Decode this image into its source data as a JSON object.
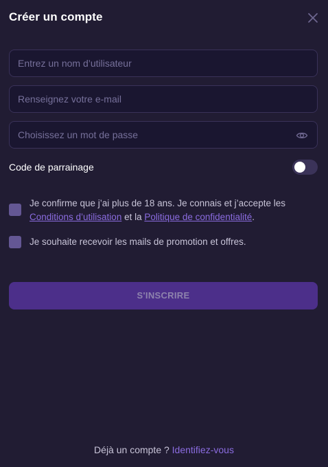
{
  "header": {
    "title": "Créer un compte"
  },
  "form": {
    "username_placeholder": "Entrez un nom d’utilisateur",
    "email_placeholder": "Renseignez votre e-mail",
    "password_placeholder": "Choisissez un mot de passe",
    "referral_label": "Code de parrainage",
    "referral_toggle_on": false,
    "terms_text_1": "Je confirme que j’ai plus de 18 ans. Je connais et j’accepte les ",
    "terms_link": "Conditions d’utilisation",
    "terms_text_2": " et la ",
    "privacy_link": "Politique de confidentialité",
    "terms_text_3": ".",
    "terms_checked": false,
    "promo_text": "Je souhaite recevoir les mails de promotion et offres.",
    "promo_checked": false,
    "submit_label": "S'INSCRIRE"
  },
  "footer": {
    "question": "Déjà un compte ? ",
    "login_link": "Identifiez-vous"
  },
  "icons": {
    "close": "close-icon",
    "password_visibility": "eye-icon"
  },
  "colors": {
    "background": "#211c33",
    "field_background": "#1a1630",
    "field_border": "#3a3259",
    "accent_link": "#8b6ce0",
    "submit_background": "#4c2f8a",
    "checkbox": "#645794"
  }
}
